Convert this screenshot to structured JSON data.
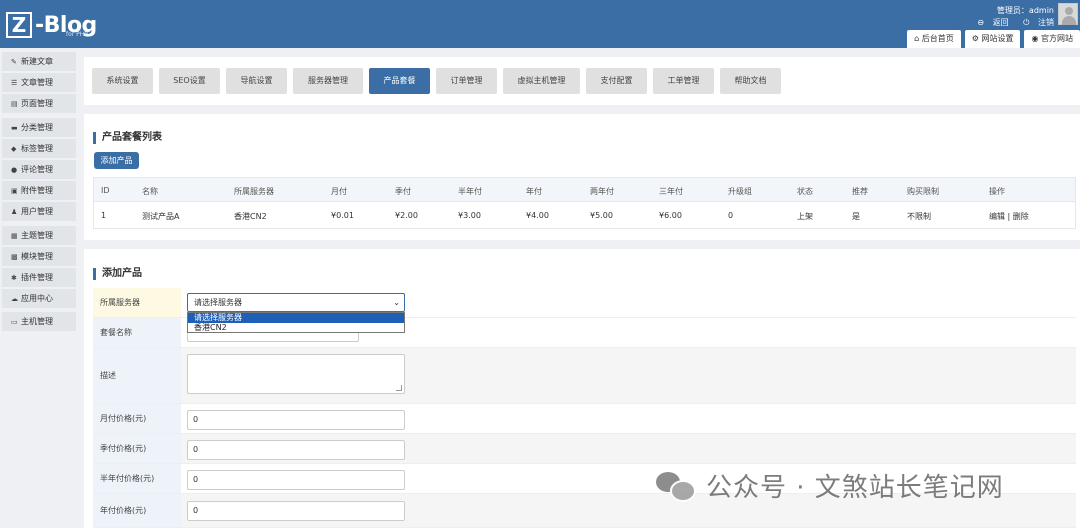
{
  "header": {
    "logo_mark": "Z",
    "logo_text": "-Blog",
    "logo_sub": "for PHP",
    "user_label": "管理员：admin",
    "back_link": "返回",
    "logout_link": "注销"
  },
  "top_nav": [
    {
      "icon": "home-icon",
      "label": "后台首页"
    },
    {
      "icon": "gear-icon",
      "label": "网站设置"
    },
    {
      "icon": "globe-icon",
      "label": "官方网站"
    }
  ],
  "sidebar": {
    "items": [
      {
        "label": "新建文章",
        "icon": "pen-icon"
      },
      {
        "label": "文章管理",
        "icon": "articles-icon"
      },
      {
        "label": "页面管理",
        "icon": "page-icon"
      },
      {
        "label": "分类管理",
        "icon": "folder-icon"
      },
      {
        "label": "标签管理",
        "icon": "tag-icon"
      },
      {
        "label": "评论管理",
        "icon": "comment-icon"
      },
      {
        "label": "附件管理",
        "icon": "attachment-icon"
      },
      {
        "label": "用户管理",
        "icon": "users-icon"
      },
      {
        "label": "主题管理",
        "icon": "theme-icon"
      },
      {
        "label": "模块管理",
        "icon": "grid-icon"
      },
      {
        "label": "插件管理",
        "icon": "puzzle-icon"
      },
      {
        "label": "应用中心",
        "icon": "cloud-icon"
      },
      {
        "label": "主机管理",
        "icon": "server-icon"
      }
    ]
  },
  "tabs": [
    {
      "label": "系统设置"
    },
    {
      "label": "SEO设置"
    },
    {
      "label": "导航设置"
    },
    {
      "label": "服务器管理"
    },
    {
      "label": "产品套餐"
    },
    {
      "label": "订单管理"
    },
    {
      "label": "虚拟主机管理"
    },
    {
      "label": "支付配置"
    },
    {
      "label": "工单管理"
    },
    {
      "label": "帮助文档"
    }
  ],
  "active_tab": "产品套餐",
  "list_section": {
    "title": "产品套餐列表",
    "add_button": "添加产品",
    "columns": [
      "ID",
      "名称",
      "所属服务器",
      "月付",
      "季付",
      "半年付",
      "年付",
      "两年付",
      "三年付",
      "升级组",
      "状态",
      "推荐",
      "购买限制",
      "操作"
    ],
    "rows": [
      {
        "id": "1",
        "name": "测试产品A",
        "server": "香港CN2",
        "monthly": "¥0.01",
        "quarterly": "¥2.00",
        "half_year": "¥3.00",
        "yearly": "¥4.00",
        "two_year": "¥5.00",
        "three_year": "¥6.00",
        "upgrade_group": "0",
        "status": "上架",
        "recommend": "是",
        "limit": "不限制",
        "edit": "编辑",
        "sep": "|",
        "delete": "删除"
      }
    ]
  },
  "form_section": {
    "title": "添加产品",
    "server_label": "所属服务器",
    "server_value": "请选择服务器",
    "server_options": [
      "请选择服务器",
      "香港CN2"
    ],
    "name_label": "套餐名称",
    "desc_label": "描述",
    "monthly_label": "月付价格(元)",
    "monthly_value": "0",
    "quarterly_label": "季付价格(元)",
    "quarterly_value": "0",
    "half_label": "半年付价格(元)",
    "half_value": "0",
    "yearly_label": "年付价格(元)",
    "yearly_value": "0"
  },
  "watermark": "公众号 · 文煞站长笔记网"
}
